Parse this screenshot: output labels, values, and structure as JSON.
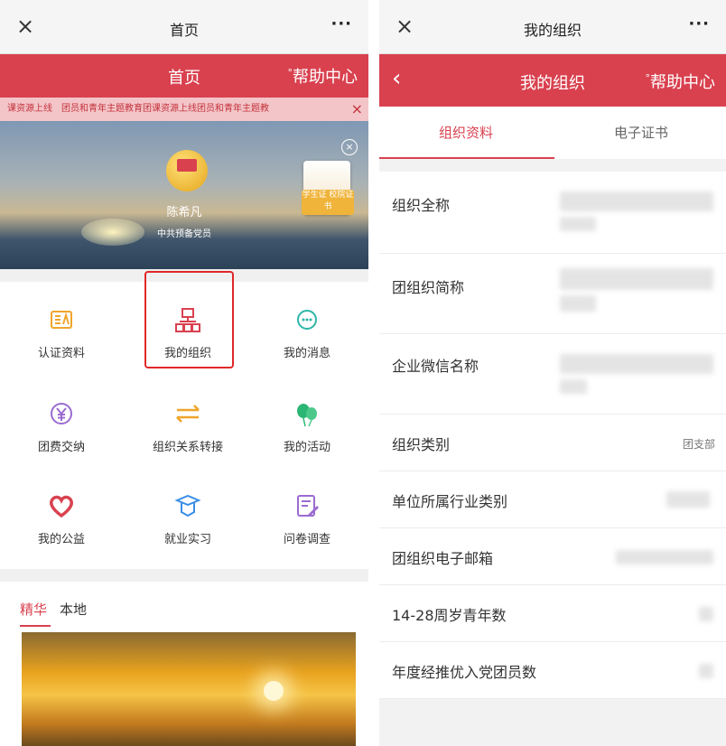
{
  "left": {
    "topbar": {
      "close": "×",
      "title": "首页",
      "more": "···"
    },
    "redbar": {
      "title": "首页",
      "help": "帮助中心",
      "help_mark": "°"
    },
    "ticker": {
      "text": "课资源上线　团员和青年主题教育团课资源上线团员和青年主题教",
      "close": "×"
    },
    "profile": {
      "name": "陈希凡",
      "title": "中共预备党员",
      "cert_label": "学生证 校院证书"
    },
    "grid": [
      {
        "label": "认证资料",
        "icon": "id-card-icon"
      },
      {
        "label": "我的组织",
        "icon": "org-chart-icon"
      },
      {
        "label": "我的消息",
        "icon": "chat-bubble-icon"
      },
      {
        "label": "团费交纳",
        "icon": "yuan-coin-icon"
      },
      {
        "label": "组织关系转接",
        "icon": "transfer-arrows-icon"
      },
      {
        "label": "我的活动",
        "icon": "balloons-icon"
      },
      {
        "label": "我的公益",
        "icon": "heart-icon"
      },
      {
        "label": "就业实习",
        "icon": "graduation-cap-icon"
      },
      {
        "label": "问卷调查",
        "icon": "survey-edit-icon"
      }
    ],
    "feed_tabs": [
      {
        "label": "精华"
      },
      {
        "label": "本地"
      }
    ]
  },
  "right": {
    "topbar": {
      "close": "×",
      "title": "我的组织",
      "more": "···"
    },
    "redbar": {
      "back": "‹",
      "title": "我的组织",
      "help": "帮助中心",
      "help_mark": "°"
    },
    "tabs": [
      {
        "label": "组织资料"
      },
      {
        "label": "电子证书"
      }
    ],
    "rows": [
      {
        "label": "组织全称",
        "value": ""
      },
      {
        "label": "团组织简称",
        "value": ""
      },
      {
        "label": "企业微信名称",
        "value": ""
      },
      {
        "label": "组织类别",
        "value": "团支部"
      },
      {
        "label": "单位所属行业类别",
        "value": ""
      },
      {
        "label": "团组织电子邮箱",
        "value": ""
      },
      {
        "label": "14-28周岁青年数",
        "value": ""
      },
      {
        "label": "年度经推优入党团员数",
        "value": ""
      }
    ]
  },
  "colors": {
    "brand_red": "#d9414f",
    "highlight_red": "#e02828"
  }
}
